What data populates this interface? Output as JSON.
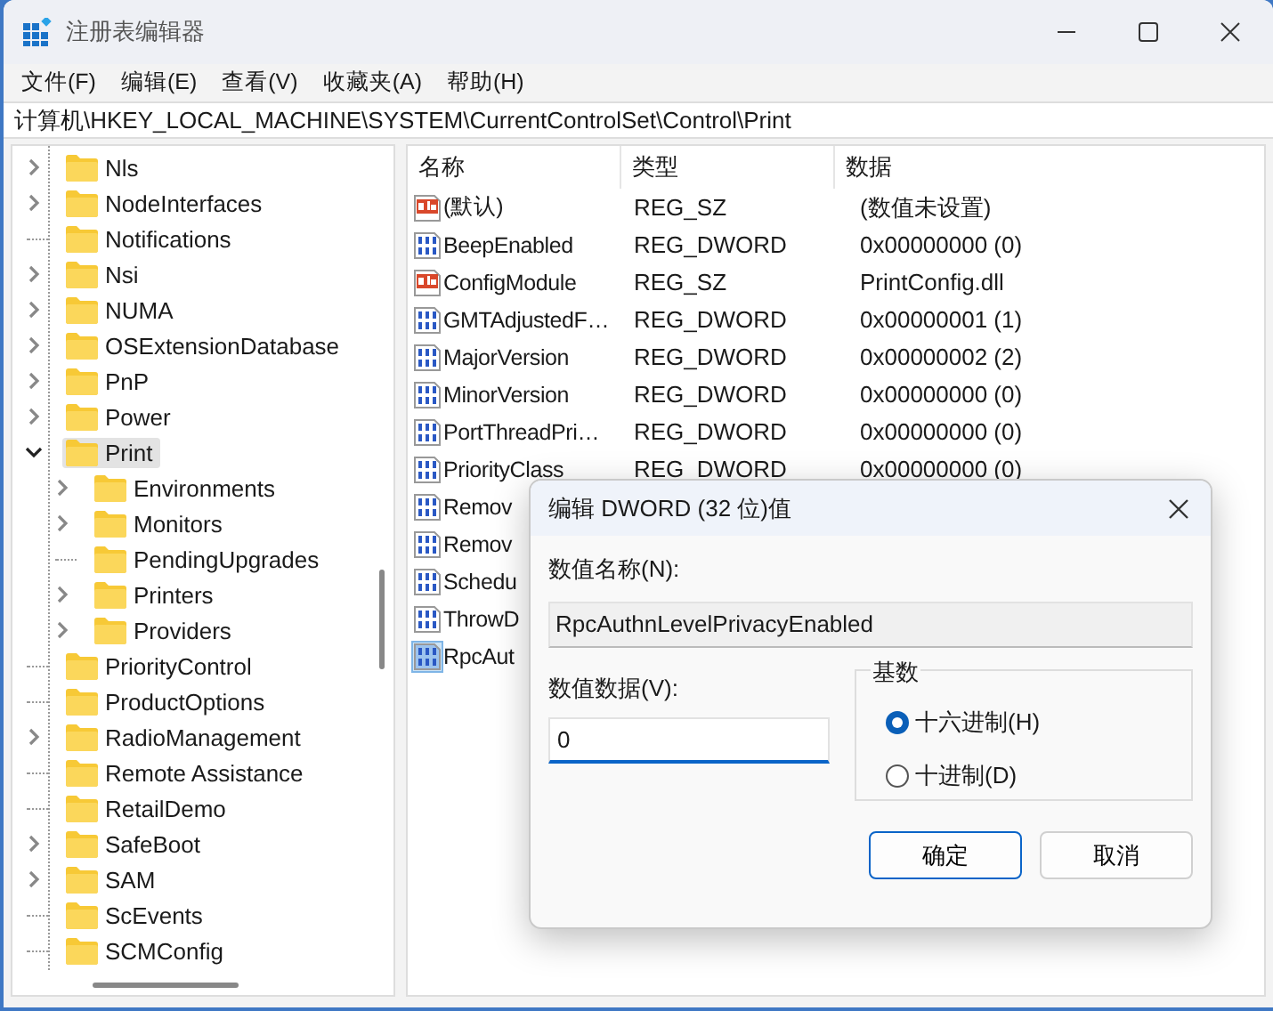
{
  "window": {
    "title": "注册表编辑器"
  },
  "menu": [
    "文件(F)",
    "编辑(E)",
    "查看(V)",
    "收藏夹(A)",
    "帮助(H)"
  ],
  "address": "计算机\\HKEY_LOCAL_MACHINE\\SYSTEM\\CurrentControlSet\\Control\\Print",
  "tree": [
    {
      "label": "Nls",
      "has_children": true,
      "expanded": false,
      "selected": false
    },
    {
      "label": "NodeInterfaces",
      "has_children": true,
      "expanded": false,
      "selected": false
    },
    {
      "label": "Notifications",
      "has_children": false,
      "expanded": false,
      "selected": false
    },
    {
      "label": "Nsi",
      "has_children": true,
      "expanded": false,
      "selected": false
    },
    {
      "label": "NUMA",
      "has_children": true,
      "expanded": false,
      "selected": false
    },
    {
      "label": "OSExtensionDatabase",
      "has_children": true,
      "expanded": false,
      "selected": false
    },
    {
      "label": "PnP",
      "has_children": true,
      "expanded": false,
      "selected": false
    },
    {
      "label": "Power",
      "has_children": true,
      "expanded": false,
      "selected": false
    },
    {
      "label": "Print",
      "has_children": true,
      "expanded": true,
      "selected": true,
      "children": [
        {
          "label": "Environments",
          "has_children": true,
          "expanded": false,
          "selected": false
        },
        {
          "label": "Monitors",
          "has_children": true,
          "expanded": false,
          "selected": false
        },
        {
          "label": "PendingUpgrades",
          "has_children": false,
          "expanded": false,
          "selected": false
        },
        {
          "label": "Printers",
          "has_children": true,
          "expanded": false,
          "selected": false
        },
        {
          "label": "Providers",
          "has_children": true,
          "expanded": false,
          "selected": false
        }
      ]
    },
    {
      "label": "PriorityControl",
      "has_children": false,
      "expanded": false,
      "selected": false
    },
    {
      "label": "ProductOptions",
      "has_children": false,
      "expanded": false,
      "selected": false
    },
    {
      "label": "RadioManagement",
      "has_children": true,
      "expanded": false,
      "selected": false
    },
    {
      "label": "Remote Assistance",
      "has_children": false,
      "expanded": false,
      "selected": false
    },
    {
      "label": "RetailDemo",
      "has_children": false,
      "expanded": false,
      "selected": false
    },
    {
      "label": "SafeBoot",
      "has_children": true,
      "expanded": false,
      "selected": false
    },
    {
      "label": "SAM",
      "has_children": true,
      "expanded": false,
      "selected": false
    },
    {
      "label": "ScEvents",
      "has_children": false,
      "expanded": false,
      "selected": false
    },
    {
      "label": "SCMConfig",
      "has_children": false,
      "expanded": false,
      "selected": false
    }
  ],
  "table": {
    "columns": [
      "名称",
      "类型",
      "数据"
    ],
    "rows": [
      {
        "kind": "string",
        "name": "(默认)",
        "type": "REG_SZ",
        "data": "(数值未设置)",
        "selected": false
      },
      {
        "kind": "dword",
        "name": "BeepEnabled",
        "type": "REG_DWORD",
        "data": "0x00000000 (0)",
        "selected": false
      },
      {
        "kind": "string",
        "name": "ConfigModule",
        "type": "REG_SZ",
        "data": "PrintConfig.dll",
        "selected": false
      },
      {
        "kind": "dword",
        "name": "GMTAdjustedF…",
        "type": "REG_DWORD",
        "data": "0x00000001 (1)",
        "selected": false
      },
      {
        "kind": "dword",
        "name": "MajorVersion",
        "type": "REG_DWORD",
        "data": "0x00000002 (2)",
        "selected": false
      },
      {
        "kind": "dword",
        "name": "MinorVersion",
        "type": "REG_DWORD",
        "data": "0x00000000 (0)",
        "selected": false
      },
      {
        "kind": "dword",
        "name": "PortThreadPri…",
        "type": "REG_DWORD",
        "data": "0x00000000 (0)",
        "selected": false
      },
      {
        "kind": "dword",
        "name": "PriorityClass",
        "type": "REG_DWORD",
        "data": "0x00000000 (0)",
        "selected": false
      },
      {
        "kind": "dword",
        "name": "Remov",
        "selected": false
      },
      {
        "kind": "dword",
        "name": "Remov",
        "selected": false
      },
      {
        "kind": "dword",
        "name": "Schedu",
        "selected": false
      },
      {
        "kind": "dword",
        "name": "ThrowD",
        "selected": false
      },
      {
        "kind": "dword",
        "name": "RpcAut",
        "selected": true
      }
    ]
  },
  "dialog": {
    "title": "编辑 DWORD (32 位)值",
    "name_label": "数值名称(N):",
    "name_value": "RpcAuthnLevelPrivacyEnabled",
    "data_label": "数值数据(V):",
    "data_value": "0",
    "radix_legend": "基数",
    "radios": [
      {
        "label": "十六进制(H)",
        "selected": true
      },
      {
        "label": "十进制(D)",
        "selected": false
      }
    ],
    "buttons": [
      {
        "label": "确定",
        "default": true
      },
      {
        "label": "取消",
        "default": false
      }
    ]
  }
}
